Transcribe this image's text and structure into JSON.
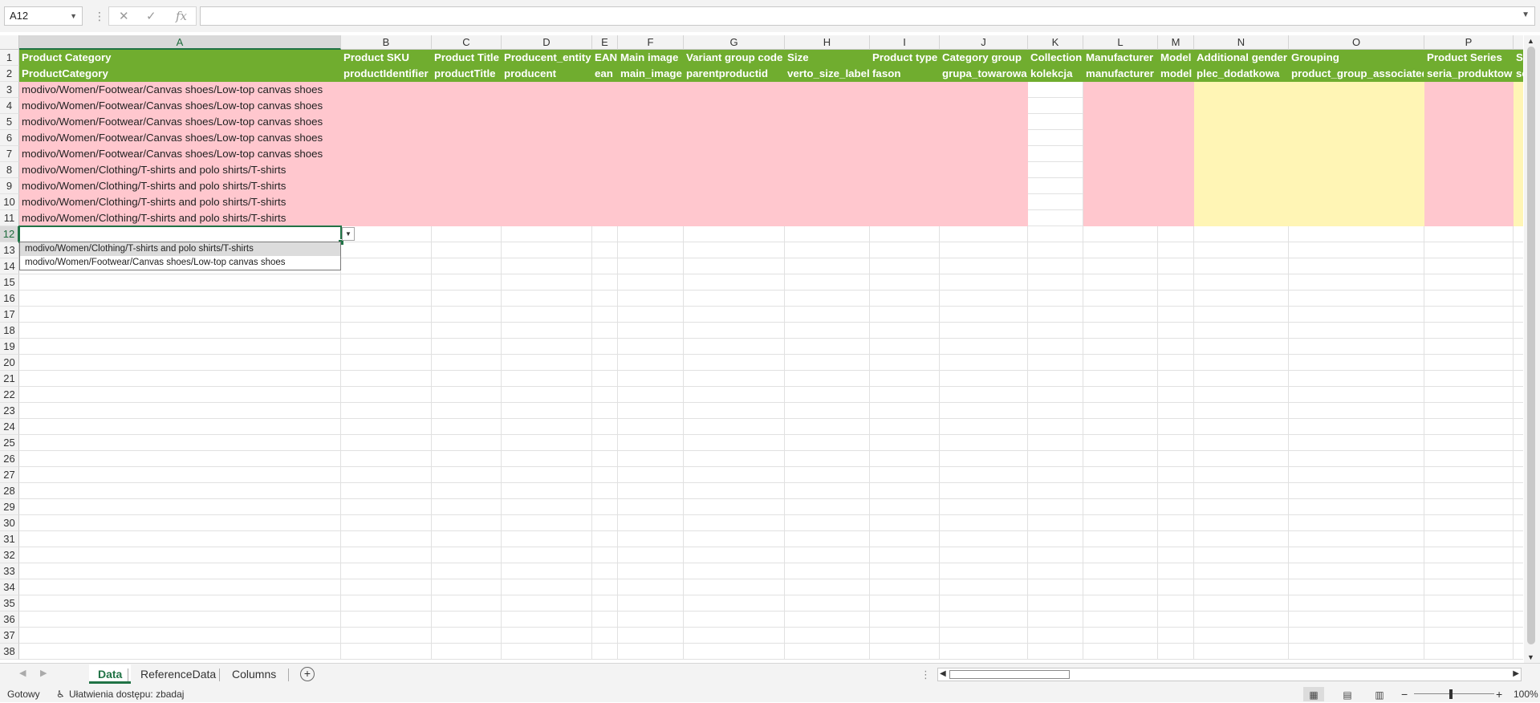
{
  "formula_bar": {
    "name_box": "A12",
    "cancel_icon": "✕",
    "enter_icon": "✓",
    "fx_label": "fx",
    "formula": ""
  },
  "columns": [
    "A",
    "B",
    "C",
    "D",
    "E",
    "F",
    "G",
    "H",
    "I",
    "J",
    "K",
    "L",
    "M",
    "N",
    "O",
    "P",
    ""
  ],
  "selected_column": "A",
  "header_row1": [
    "Product Category",
    "Product SKU",
    "Product Title",
    "Producent_entity",
    "EAN",
    "Main image",
    "Variant group code",
    "Size",
    "Product type",
    "Category group",
    "Collection",
    "Manufacturer",
    "Model",
    "Additional gender",
    "Grouping",
    "Product Series",
    "Se"
  ],
  "header_row2": [
    "ProductCategory",
    "productIdentifier",
    "productTitle",
    "producent",
    "ean",
    "main_image",
    "parentproductid",
    "verto_size_label",
    "fason",
    "grupa_towarowa",
    "kolekcja",
    "manufacturer",
    "model",
    "plec_dodatkowa",
    "product_group_associated",
    "seria_produktow",
    "se"
  ],
  "data_rows": [
    "modivo/Women/Footwear/Canvas shoes/Low-top canvas shoes",
    "modivo/Women/Footwear/Canvas shoes/Low-top canvas shoes",
    "modivo/Women/Footwear/Canvas shoes/Low-top canvas shoes",
    "modivo/Women/Footwear/Canvas shoes/Low-top canvas shoes",
    "modivo/Women/Footwear/Canvas shoes/Low-top canvas shoes",
    "modivo/Women/Clothing/T-shirts and polo shirts/T-shirts",
    "modivo/Women/Clothing/T-shirts and polo shirts/T-shirts",
    "modivo/Women/Clothing/T-shirts and polo shirts/T-shirts",
    "modivo/Women/Clothing/T-shirts and polo shirts/T-shirts"
  ],
  "row_numbers": [
    "1",
    "2",
    "3",
    "4",
    "5",
    "6",
    "7",
    "8",
    "9",
    "10",
    "11",
    "12",
    "13",
    "14",
    "15",
    "16",
    "17",
    "18",
    "19",
    "20",
    "21",
    "22",
    "23",
    "24",
    "25",
    "26",
    "27",
    "28",
    "29",
    "30",
    "31",
    "32",
    "33",
    "34",
    "35",
    "36",
    "37",
    "38"
  ],
  "active_row": "12",
  "dropdown": {
    "options": [
      "modivo/Women/Clothing/T-shirts and polo shirts/T-shirts",
      "modivo/Women/Footwear/Canvas shoes/Low-top canvas shoes"
    ],
    "highlighted_index": 0
  },
  "sheet_tabs": [
    "Data",
    "ReferenceData",
    "Columns"
  ],
  "active_tab": "Data",
  "status": {
    "ready": "Gotowy",
    "accessibility": "Ułatwienia dostępu: zbadaj",
    "zoom": "100%"
  },
  "colors": {
    "header_green": "#70ad2f",
    "required_pink": "#ffc7ce",
    "optional_yellow": "#fff5b5",
    "accent": "#217346"
  },
  "fill_pattern": [
    "pink",
    "pink",
    "pink",
    "pink",
    "pink",
    "pink",
    "pink",
    "pink",
    "pink",
    "pink",
    "none",
    "pink",
    "pink",
    "yellow",
    "yellow",
    "pink",
    "yellow"
  ]
}
